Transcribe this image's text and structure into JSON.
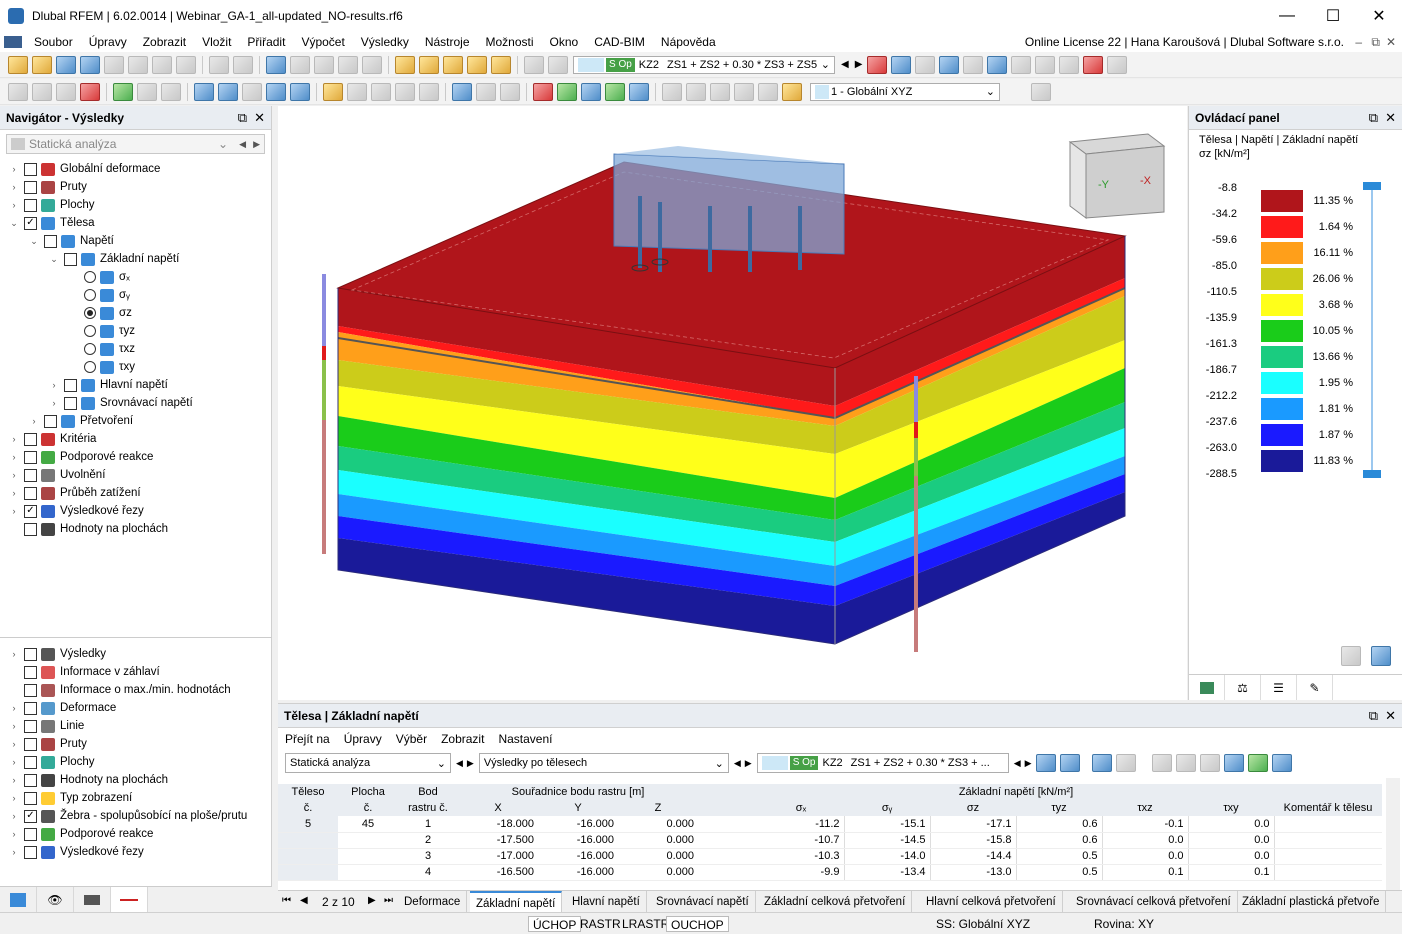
{
  "window": {
    "title": "Dlubal RFEM | 6.02.0014 | Webinar_GA-1_all-updated_NO-results.rf6"
  },
  "menu": {
    "items": [
      "Soubor",
      "Úpravy",
      "Zobrazit",
      "Vložit",
      "Přiřadit",
      "Výpočet",
      "Výsledky",
      "Nástroje",
      "Možnosti",
      "Okno",
      "CAD-BIM",
      "Nápověda"
    ],
    "license": "Online License 22 | Hana Karoušová | Dlubal Software s.r.o."
  },
  "toolbar": {
    "so_label": "S Op",
    "kz": "KZ2",
    "combo_formula": "ZS1 + ZS2 + 0.30 * ZS3 + ZS5",
    "coord_system": "1 - Globální XYZ"
  },
  "navigator": {
    "title": "Navigátor - Výsledky",
    "combo": "Statická analýza",
    "items": [
      {
        "label": "Globální deformace",
        "checked": false
      },
      {
        "label": "Pruty",
        "checked": false
      },
      {
        "label": "Plochy",
        "checked": false
      },
      {
        "label": "Tělesa",
        "checked": true
      },
      {
        "label": "Napětí",
        "checked": false
      },
      {
        "label": "Základní napětí",
        "checked": false
      },
      {
        "label": "σₓ"
      },
      {
        "label": "σᵧ"
      },
      {
        "label": "σz"
      },
      {
        "label": "τyz"
      },
      {
        "label": "τxz"
      },
      {
        "label": "τxy"
      },
      {
        "label": "Hlavní napětí",
        "checked": false
      },
      {
        "label": "Srovnávací napětí",
        "checked": false
      },
      {
        "label": "Přetvoření",
        "checked": false
      },
      {
        "label": "Kritéria",
        "checked": false
      },
      {
        "label": "Podporové reakce",
        "checked": false
      },
      {
        "label": "Uvolnění",
        "checked": false
      },
      {
        "label": "Průběh zatížení",
        "checked": false
      },
      {
        "label": "Výsledkové řezy",
        "checked": true
      },
      {
        "label": "Hodnoty na plochách",
        "checked": false
      }
    ],
    "items2": [
      {
        "label": "Výsledky",
        "checked": false
      },
      {
        "label": "Informace v záhlaví",
        "checked": false
      },
      {
        "label": "Informace o max./min. hodnotách",
        "checked": false
      },
      {
        "label": "Deformace",
        "checked": false
      },
      {
        "label": "Linie",
        "checked": false
      },
      {
        "label": "Pruty",
        "checked": false
      },
      {
        "label": "Plochy",
        "checked": false
      },
      {
        "label": "Hodnoty na plochách",
        "checked": false
      },
      {
        "label": "Typ zobrazení",
        "checked": false
      },
      {
        "label": "Žebra - spolupůsobící na ploše/prutu",
        "checked": true
      },
      {
        "label": "Podporové reakce",
        "checked": false
      },
      {
        "label": "Výsledkové řezy",
        "checked": false
      }
    ]
  },
  "control_panel": {
    "title": "Ovládací panel",
    "subtitle": "Tělesa | Napětí | Základní napětí",
    "unit": "σz [kN/m²]",
    "legend_values": [
      "-8.8",
      "-34.2",
      "-59.6",
      "-85.0",
      "-110.5",
      "-135.9",
      "-161.3",
      "-186.7",
      "-212.2",
      "-237.6",
      "-263.0",
      "-288.5"
    ],
    "legend_colors": [
      "#b0151b",
      "#ff1a1a",
      "#ff9f1a",
      "#cccc1a",
      "#ffff1a",
      "#1acc1a",
      "#1acc80",
      "#1affff",
      "#1a9aff",
      "#1a1aff",
      "#1a1a99"
    ],
    "legend_percents": [
      "11.35 %",
      "1.64 %",
      "16.11 %",
      "26.06 %",
      "3.68 %",
      "10.05 %",
      "13.66 %",
      "1.95 %",
      "1.81 %",
      "1.87 %",
      "11.83 %"
    ]
  },
  "table": {
    "title": "Tělesa | Základní napětí",
    "menu": [
      "Přejít na",
      "Úpravy",
      "Výběr",
      "Zobrazit",
      "Nastavení"
    ],
    "combo1": "Statická analýza",
    "combo2": "Výsledky po tělesech",
    "so": "S Op",
    "kz": "KZ2",
    "combo3": "ZS1 + ZS2 + 0.30 * ZS3 + ...",
    "headers": {
      "teleso": "Těleso",
      "teleso2": "č.",
      "plocha": "Plocha",
      "plocha2": "č.",
      "bod": "Bod",
      "bod2": "rastru č.",
      "coord": "Souřadnice bodu rastru [m]",
      "x": "X",
      "y": "Y",
      "z": "Z",
      "stress": "Základní napětí [kN/m²]",
      "sx": "σₓ",
      "sy": "σᵧ",
      "sz": "σz",
      "tyz": "τyz",
      "txz": "τxz",
      "txy": "τxy",
      "comment": "Komentář k tělesu"
    },
    "rows": [
      {
        "teleso": "5",
        "plocha": "45",
        "bod": "1",
        "x": "-18.000",
        "y": "-16.000",
        "z": "0.000",
        "sx": "-11.2",
        "sy": "-15.1",
        "sz": "-17.1",
        "tyz": "0.6",
        "txz": "-0.1",
        "txy": "0.0"
      },
      {
        "teleso": "",
        "plocha": "",
        "bod": "2",
        "x": "-17.500",
        "y": "-16.000",
        "z": "0.000",
        "sx": "-10.7",
        "sy": "-14.5",
        "sz": "-15.8",
        "tyz": "0.6",
        "txz": "0.0",
        "txy": "0.0"
      },
      {
        "teleso": "",
        "plocha": "",
        "bod": "3",
        "x": "-17.000",
        "y": "-16.000",
        "z": "0.000",
        "sx": "-10.3",
        "sy": "-14.0",
        "sz": "-14.4",
        "tyz": "0.5",
        "txz": "0.0",
        "txy": "0.0"
      },
      {
        "teleso": "",
        "plocha": "",
        "bod": "4",
        "x": "-16.500",
        "y": "-16.000",
        "z": "0.000",
        "sx": "-9.9",
        "sy": "-13.4",
        "sz": "-13.0",
        "tyz": "0.5",
        "txz": "0.1",
        "txy": "0.1"
      }
    ],
    "page": "2 z 10",
    "tabs": [
      "Deformace",
      "Základní napětí",
      "Hlavní napětí",
      "Srovnávací napětí",
      "Základní celková přetvoření",
      "Hlavní celková přetvoření",
      "Srovnávací celková přetvoření",
      "Základní plastická přetvoře"
    ]
  },
  "status": {
    "items": [
      "ÚCHOP",
      "RASTR",
      "LRASTR",
      "OUCHOP",
      "SS: Globální XYZ",
      "Rovina: XY"
    ]
  }
}
